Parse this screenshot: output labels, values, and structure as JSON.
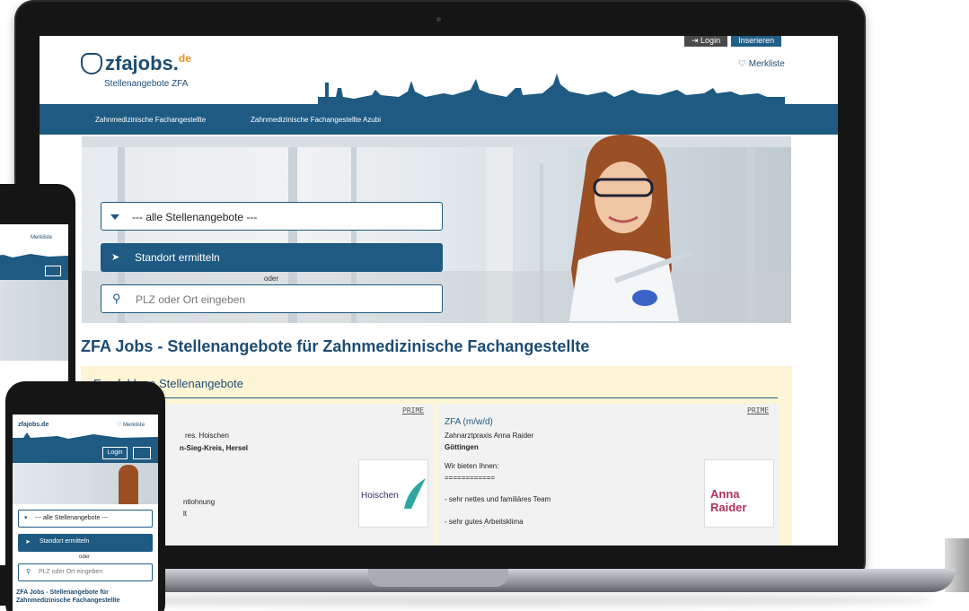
{
  "header": {
    "logo_main": "zfajobs.",
    "logo_tld": "de",
    "tagline": "Stellenangebote ZFA",
    "login_label": "Login",
    "insert_label": "Inserieren",
    "merkliste_label": "Merkliste"
  },
  "nav": {
    "items": [
      "Zahnmedizinische Fachangestellte",
      "Zahnmedizinische Fachangestellte Azubi"
    ]
  },
  "search": {
    "category_selected": "--- alle Stellenangebote ---",
    "locate_label": "Standort ermitteln",
    "or_label": "oder",
    "location_placeholder": "PLZ oder Ort eingeben"
  },
  "page": {
    "title": "ZFA Jobs - Stellenangebote für Zahnmedizinische Fachangestellte"
  },
  "featured": {
    "heading": "Empfohlene Stellenangebote",
    "jobs": [
      {
        "prime": "PRIME",
        "employer_partial": "res. Hoischen",
        "location_partial": "n-Sieg-Kreis, Hersel",
        "line1": "ntlohnung",
        "line2": "lt",
        "logo_text": "Hoischen"
      },
      {
        "prime": "PRIME",
        "title": "ZFA (m/w/d)",
        "employer": "Zahnarztpraxis Anna Raider",
        "location": "Göttingen",
        "intro": "Wir bieten Ihnen:",
        "separator": "============",
        "bullet1": "- sehr nettes und familiäres Team",
        "bullet2": "- sehr gutes Arbeitsklima",
        "logo_text": "Anna Raider"
      }
    ]
  },
  "mobile": {
    "logo": "zfajobs.de",
    "merkliste_label": "Merkliste",
    "login_label": "Login",
    "category_selected": "--- alle Stellenangebote ---",
    "locate_label": "Standort ermitteln",
    "or_label": "oder",
    "location_placeholder": "PLZ oder Ort eingeben",
    "title": "ZFA Jobs - Stellenangebote für Zahnmedizinische Fachangestellte"
  },
  "colors": {
    "primary": "#1e5a82",
    "accent": "#e8901b",
    "featured_bg": "#fdf5d6"
  }
}
